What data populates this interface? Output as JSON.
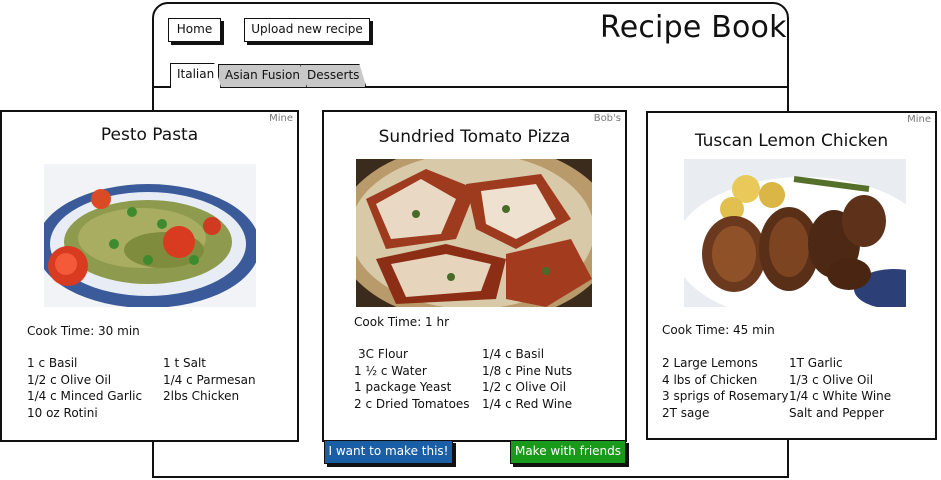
{
  "header": {
    "home_label": "Home",
    "upload_label": "Upload new recipe",
    "app_title": "Recipe Book"
  },
  "tabs": [
    {
      "label": "Italian",
      "active": true
    },
    {
      "label": "Asian Fusion",
      "active": false
    },
    {
      "label": "Desserts",
      "active": false
    }
  ],
  "recipes": [
    {
      "owner": "Mine",
      "title": "Pesto Pasta",
      "photo": "pesto-pasta-photo",
      "cook_time": "Cook Time: 30 min",
      "ingredients_left": [
        "1 c Basil",
        "1/2 c Olive Oil",
        "1/4 c Minced Garlic",
        "10 oz Rotini"
      ],
      "ingredients_right": [
        "1 t Salt",
        "1/4 c Parmesan",
        "2lbs Chicken"
      ]
    },
    {
      "owner": "Bob's",
      "title": "Sundried Tomato Pizza",
      "photo": "pizza-photo",
      "cook_time": "Cook Time: 1 hr",
      "ingredients_left": [
        "3C Flour",
        "1 ½ c Water",
        "1 package Yeast",
        "2 c Dried Tomatoes"
      ],
      "ingredients_right": [
        "1/4 c Basil",
        "1/8 c Pine Nuts",
        "1/2 c Olive Oil",
        "1/4 c Red Wine"
      ]
    },
    {
      "owner": "Mine",
      "title": "Tuscan Lemon Chicken",
      "photo": "lemon-chicken-photo",
      "cook_time": "Cook Time: 45 min",
      "ingredients_left": [
        "2 Large Lemons",
        "4 lbs of Chicken",
        "3 sprigs of Rosemary",
        "2T sage"
      ],
      "ingredients_right": [
        "1T Garlic",
        "1/3 c Olive Oil",
        "1/4 c White Wine",
        "Salt and Pepper"
      ]
    }
  ],
  "actions": {
    "make_label": "I want to make this!",
    "friends_label": "Make with friends"
  },
  "colors": {
    "make_button": "#1a5fa6",
    "friends_button": "#1a9a1a",
    "inactive_tab": "#c8c8c8"
  }
}
